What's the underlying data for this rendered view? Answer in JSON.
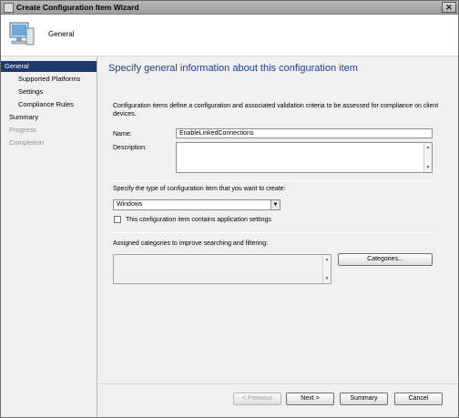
{
  "window": {
    "title": "Create Configuration Item Wizard",
    "close_glyph": "✕"
  },
  "header": {
    "title": "General"
  },
  "nav": {
    "items": [
      {
        "label": "General",
        "state": "active"
      },
      {
        "label": "Supported Platforms",
        "state": "normal"
      },
      {
        "label": "Settings",
        "state": "normal"
      },
      {
        "label": "Compliance Rules",
        "state": "normal"
      },
      {
        "label": "Summary",
        "state": "normal"
      },
      {
        "label": "Progress",
        "state": "disabled"
      },
      {
        "label": "Completion",
        "state": "disabled"
      }
    ]
  },
  "main": {
    "heading": "Specify general information about this configuration item",
    "intro": "Configuration items define a configuration and associated validation criteria to be assessed for compliance on client devices.",
    "name_label": "Name:",
    "name_value": "EnableLinkedConnections",
    "description_label": "Description:",
    "description_value": "",
    "type_label": "Specify the type of configuration item that you want to create:",
    "type_value": "Windows",
    "app_settings_label": "This configuration item contains application settings",
    "app_settings_checked": false,
    "categories_label": "Assigned categories to improve searching and filtering:",
    "categories_button": "Categories..."
  },
  "footer": {
    "previous": "< Previous",
    "next": "Next >",
    "summary": "Summary",
    "cancel": "Cancel"
  },
  "icons": {
    "up": "▲",
    "down": "▼"
  }
}
